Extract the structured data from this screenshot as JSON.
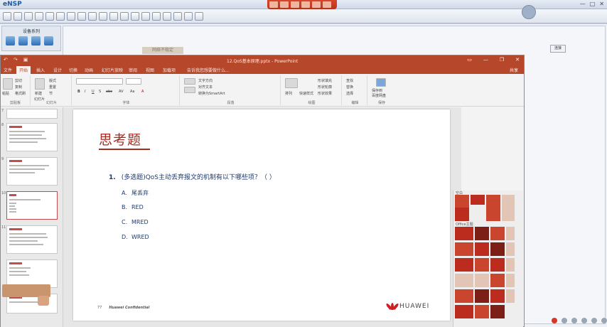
{
  "ensp": {
    "app_name": "eNSP",
    "device_panel_title": "设备系列",
    "side_button": "连接",
    "ghost_label": "网络不稳定",
    "window_controls": [
      "—",
      "□",
      "✕"
    ]
  },
  "ppt": {
    "doc_title": "12.QoS基本原理.pptx - PowerPoint",
    "quick_access": [
      "↶",
      "↷",
      "▣"
    ],
    "window_controls": [
      "▭",
      "—",
      "❐",
      "✕"
    ],
    "tabs": [
      "文件",
      "开始",
      "插入",
      "设计",
      "切换",
      "动画",
      "幻灯片放映",
      "审阅",
      "视图",
      "加载项"
    ],
    "active_tab": "开始",
    "tell_me": "告诉我您想要做什么...",
    "share": "共享",
    "ribbon": {
      "clipboard": {
        "label": "剪贴板",
        "items": [
          "剪切",
          "复制",
          "格式刷"
        ],
        "paste": "粘贴"
      },
      "slides": {
        "label": "幻灯片",
        "items": [
          "新建",
          "幻灯片",
          "版式",
          "重置",
          "节"
        ]
      },
      "font": {
        "label": "字体",
        "items": [
          "B",
          "I",
          "U",
          "S",
          "abc",
          "AV",
          "Aa",
          "A"
        ]
      },
      "paragraph": {
        "label": "段落",
        "items": [
          "文字方向",
          "对齐文本",
          "转换为SmartArt"
        ]
      },
      "drawing": {
        "label": "绘图",
        "items": [
          "排列",
          "快速样式",
          "形状填充",
          "形状轮廓",
          "形状效果"
        ]
      },
      "editing": {
        "label": "编辑",
        "items": [
          "查找",
          "替换",
          "选择"
        ]
      },
      "save": {
        "label": "保存",
        "items": [
          "保存到",
          "百度网盘"
        ]
      }
    },
    "thumb_numbers": [
      "7",
      "8",
      "9",
      "10",
      "11"
    ],
    "slide": {
      "title": "思考题",
      "question_num": "1.",
      "question": "(多选题)QoS主动丢弃报文的机制有以下哪些项？（   ）",
      "options": [
        {
          "letter": "A.",
          "text": "尾丢弃"
        },
        {
          "letter": "B.",
          "text": "RED"
        },
        {
          "letter": "C.",
          "text": "MRED"
        },
        {
          "letter": "D.",
          "text": "WRED"
        }
      ],
      "footer_page": "77",
      "footer_text": "Huawei Confidential",
      "brand": "HUAWEI"
    },
    "design_panel": {
      "label1": "空白",
      "label2": "Office主题"
    }
  }
}
